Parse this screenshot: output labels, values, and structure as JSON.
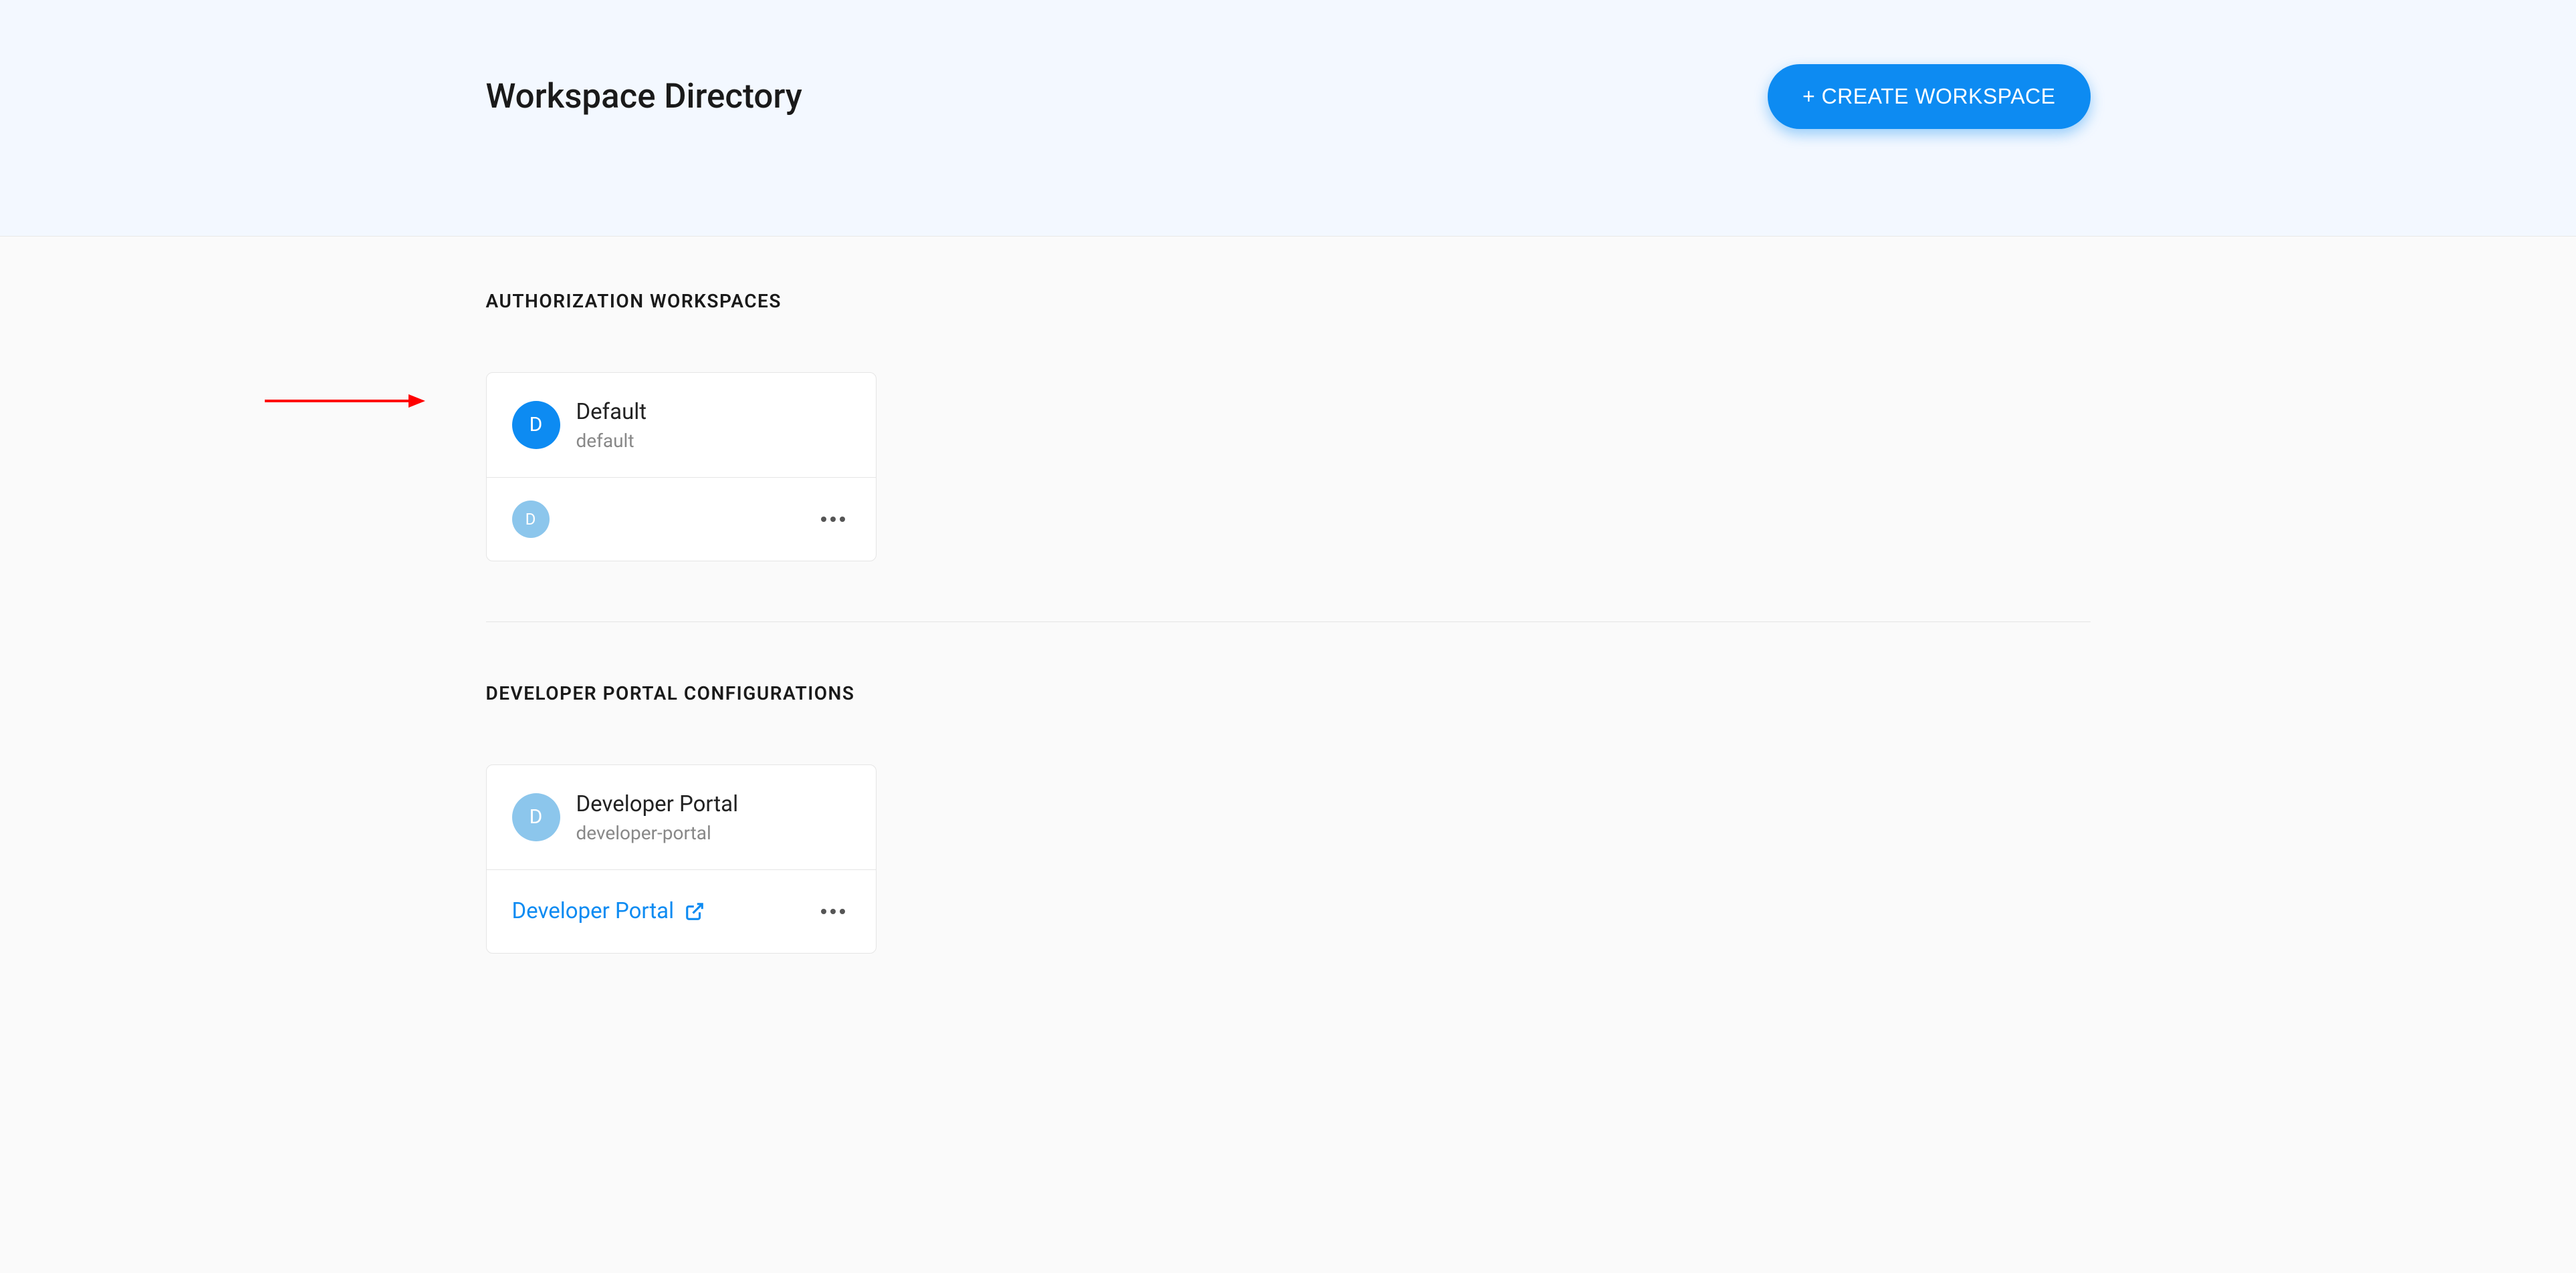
{
  "header": {
    "title": "Workspace Directory",
    "create_button": "+ CREATE WORKSPACE"
  },
  "sections": {
    "authorization": {
      "label": "AUTHORIZATION WORKSPACES",
      "card": {
        "avatar_letter": "D",
        "title": "Default",
        "subtitle": "default",
        "footer_avatar_letter": "D"
      }
    },
    "developer_portal": {
      "label": "DEVELOPER PORTAL CONFIGURATIONS",
      "card": {
        "avatar_letter": "D",
        "title": "Developer Portal",
        "subtitle": "developer-portal",
        "link_text": "Developer Portal"
      }
    }
  }
}
